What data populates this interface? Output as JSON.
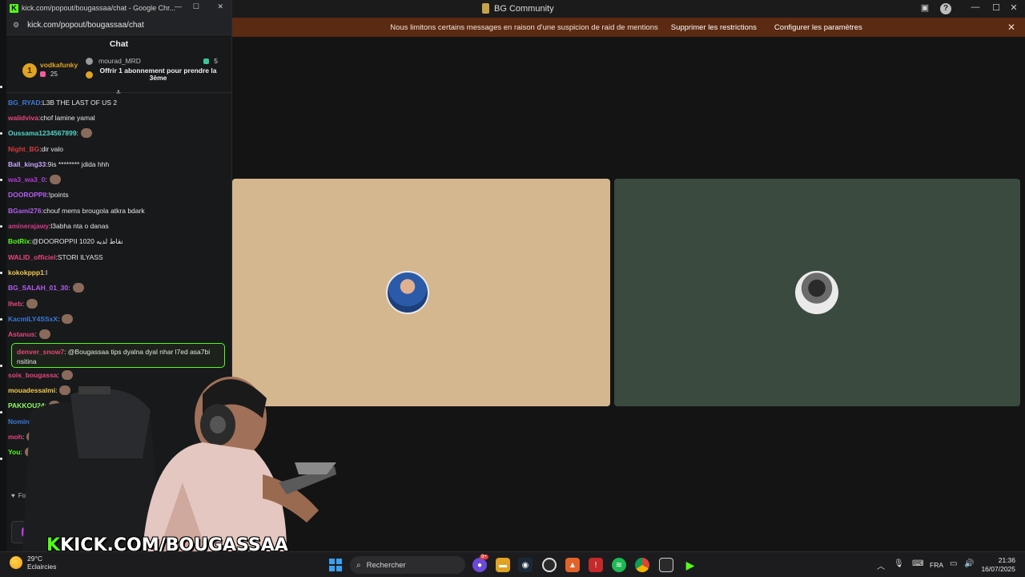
{
  "app": {
    "title": "BG Community",
    "banner_text": "Nous limitons certains messages en raison d'une suspicion de raid de mentions",
    "banner_btn_remove": "Supprimer les restrictions",
    "banner_btn_config": "Configurer les paramètres",
    "banner_close": "✕",
    "help": "?",
    "minimize": "—",
    "maximize": "☐",
    "close": "✕"
  },
  "chat_window": {
    "tab_title": "kick.com/popout/bougassaa/chat - Google Chr...",
    "url": "kick.com/popout/bougassaa/chat",
    "header": "Chat",
    "pinned": {
      "rank": "1",
      "gifter_name": "vodkafunky",
      "gifter_count": "25",
      "requester_name": "mourad_MRD",
      "requester_count": "5",
      "offer_text": "Offrir 1 abonnement pour prendre la 3ème"
    },
    "messages": [
      {
        "user": "BG_RYAD",
        "text": "L3B THE LAST OF US 2",
        "color": "#3a78d8"
      },
      {
        "user": "walidviva",
        "text": "chof lamine yamal",
        "color": "#e8457c"
      },
      {
        "user": "Oussama1234567899",
        "text": "",
        "color": "#4fd6c8"
      },
      {
        "user": "Night_BG",
        "text": "dir valo",
        "color": "#d83a3a"
      },
      {
        "user": "Ball_king33",
        "text": "9is ******** jdida hhh",
        "color": "#c7a6ff"
      },
      {
        "user": "wa3_wa3_0",
        "text": "",
        "color": "#b43ad8"
      },
      {
        "user": "DOOROPPII",
        "text": "!points",
        "color": "#b45cf2"
      },
      {
        "user": "BGami276",
        "text": "chouf mems brougola atkra bdark",
        "color": "#b45cf2"
      },
      {
        "user": "aminerajawy",
        "text": "l3abha nta o danas",
        "color": "#d83a8a"
      },
      {
        "user": "BotRix",
        "text": "@DOOROPPII 1020 نقاط لديه",
        "color": "#53fc18"
      },
      {
        "user": "WALID_officiel",
        "text": "STORI ILYASS",
        "color": "#e8457c"
      },
      {
        "user": "kokokppp1",
        "text": "l",
        "color": "#f2c94c"
      },
      {
        "user": "BG_SALAH_01_30",
        "text": "",
        "color": "#b45cf2"
      },
      {
        "user": "Iheb",
        "text": "",
        "color": "#e8457c"
      },
      {
        "user": "KacmILY4SSxX",
        "text": "",
        "color": "#3a78d8"
      },
      {
        "user": "Astanus",
        "text": "",
        "color": "#e8457c"
      }
    ],
    "highlight": {
      "user": "denver_snow7",
      "text": "@Bougassaa tips dyalna dyal nhar l7ed asa7bi nsitina"
    },
    "messages_after": [
      {
        "user": "sois_bougassa",
        "text": "",
        "color": "#e8457c"
      },
      {
        "user": "mouadessalmi",
        "text": "",
        "color": "#f2c94c"
      },
      {
        "user": "PAKKOU24",
        "text": "",
        "color": "#8dfc5a"
      },
      {
        "user": "Nominic",
        "text": "",
        "color": "#3a78d8"
      },
      {
        "user": "moh",
        "text": "",
        "color": "#e8457c"
      },
      {
        "user": "You",
        "text": "",
        "color": "#53fc18"
      }
    ],
    "follow_label": "Follow"
  },
  "overlay": {
    "watermark_k": "K",
    "watermark_rest": "KICK.COM/BOUGASSAA"
  },
  "taskbar": {
    "temperature": "29°C",
    "weather_desc": "Eclaircies",
    "search_placeholder": "Rechercher",
    "language": "FRA",
    "time": "21:36",
    "date": "16/07/2025",
    "notification_count": "9+"
  },
  "colors": {
    "kick_green": "#53fc18",
    "banner_bg": "#5b2a12",
    "tile_left": "#d4b68f",
    "tile_right": "#3a4a3f"
  }
}
